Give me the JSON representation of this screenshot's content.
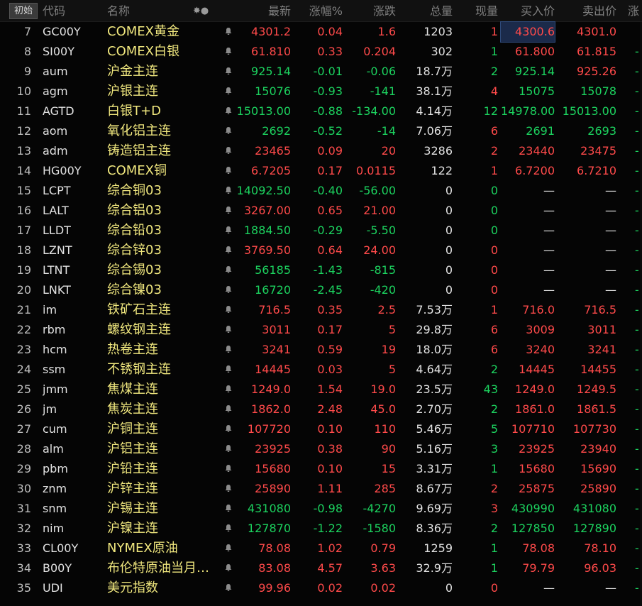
{
  "header": {
    "reset_label": "初始",
    "columns": {
      "code": "代码",
      "name": "名称",
      "icons": "✸●",
      "last": "最新",
      "pct": "涨幅%",
      "chg": "涨跌",
      "vol": "总量",
      "now": "现量",
      "bid": "买入价",
      "ask": "卖出价",
      "ext": "涨"
    }
  },
  "colors": {
    "up": "#ff4a4a",
    "down": "#1cd35f",
    "neutral": "#e2e2e2",
    "name": "#f0e77e",
    "selected_bg": "#1b2a4a"
  },
  "rows": [
    {
      "idx": "7",
      "code": "GC00Y",
      "name": "COMEX黄金",
      "last": "4301.2",
      "pct": "0.04",
      "chg": "1.6",
      "vol": "1203",
      "now": "1",
      "bid": "4300.6",
      "ask": "4301.0",
      "ext": "",
      "dir": "up",
      "now_dir": "up",
      "bid_dir": "up",
      "ask_dir": "up"
    },
    {
      "idx": "8",
      "code": "SI00Y",
      "name": "COMEX白银",
      "last": "61.810",
      "pct": "0.33",
      "chg": "0.204",
      "vol": "302",
      "now": "1",
      "bid": "61.800",
      "ask": "61.815",
      "ext": "-",
      "dir": "up",
      "now_dir": "down",
      "bid_dir": "up",
      "ask_dir": "up"
    },
    {
      "idx": "9",
      "code": "aum",
      "name": "沪金主连",
      "last": "925.14",
      "pct": "-0.01",
      "chg": "-0.06",
      "vol": "18.7万",
      "now": "2",
      "bid": "925.14",
      "ask": "925.26",
      "ext": "-",
      "dir": "down",
      "now_dir": "down",
      "bid_dir": "down",
      "ask_dir": "up"
    },
    {
      "idx": "10",
      "code": "agm",
      "name": "沪银主连",
      "last": "15076",
      "pct": "-0.93",
      "chg": "-141",
      "vol": "38.1万",
      "now": "4",
      "bid": "15075",
      "ask": "15078",
      "ext": "-",
      "dir": "down",
      "now_dir": "up",
      "bid_dir": "down",
      "ask_dir": "down"
    },
    {
      "idx": "11",
      "code": "AGTD",
      "name": "白银T+D",
      "last": "15013.00",
      "pct": "-0.88",
      "chg": "-134.00",
      "vol": "4.14万",
      "now": "12",
      "bid": "14978.00",
      "ask": "15013.00",
      "ext": "-",
      "dir": "down",
      "now_dir": "down",
      "bid_dir": "down",
      "ask_dir": "down"
    },
    {
      "idx": "12",
      "code": "aom",
      "name": "氧化铝主连",
      "last": "2692",
      "pct": "-0.52",
      "chg": "-14",
      "vol": "7.06万",
      "now": "6",
      "bid": "2691",
      "ask": "2693",
      "ext": "-",
      "dir": "down",
      "now_dir": "up",
      "bid_dir": "down",
      "ask_dir": "down"
    },
    {
      "idx": "13",
      "code": "adm",
      "name": "铸造铝主连",
      "last": "23465",
      "pct": "0.09",
      "chg": "20",
      "vol": "3286",
      "now": "2",
      "bid": "23440",
      "ask": "23475",
      "ext": "-",
      "dir": "up",
      "now_dir": "up",
      "bid_dir": "up",
      "ask_dir": "up"
    },
    {
      "idx": "14",
      "code": "HG00Y",
      "name": "COMEX铜",
      "last": "6.7205",
      "pct": "0.17",
      "chg": "0.0115",
      "vol": "122",
      "now": "1",
      "bid": "6.7200",
      "ask": "6.7210",
      "ext": "-",
      "dir": "up",
      "now_dir": "up",
      "bid_dir": "up",
      "ask_dir": "up"
    },
    {
      "idx": "15",
      "code": "LCPT",
      "name": "综合铜03",
      "last": "14092.50",
      "pct": "-0.40",
      "chg": "-56.00",
      "vol": "0",
      "now": "0",
      "bid": "—",
      "ask": "—",
      "ext": "-",
      "dir": "down",
      "now_dir": "down",
      "bid_dir": "neutral",
      "ask_dir": "neutral"
    },
    {
      "idx": "16",
      "code": "LALT",
      "name": "综合铝03",
      "last": "3267.00",
      "pct": "0.65",
      "chg": "21.00",
      "vol": "0",
      "now": "0",
      "bid": "—",
      "ask": "—",
      "ext": "-",
      "dir": "up",
      "now_dir": "down",
      "bid_dir": "neutral",
      "ask_dir": "neutral"
    },
    {
      "idx": "17",
      "code": "LLDT",
      "name": "综合铅03",
      "last": "1884.50",
      "pct": "-0.29",
      "chg": "-5.50",
      "vol": "0",
      "now": "0",
      "bid": "—",
      "ask": "—",
      "ext": "-",
      "dir": "down",
      "now_dir": "down",
      "bid_dir": "neutral",
      "ask_dir": "neutral"
    },
    {
      "idx": "18",
      "code": "LZNT",
      "name": "综合锌03",
      "last": "3769.50",
      "pct": "0.64",
      "chg": "24.00",
      "vol": "0",
      "now": "0",
      "bid": "—",
      "ask": "—",
      "ext": "-",
      "dir": "up",
      "now_dir": "up",
      "bid_dir": "neutral",
      "ask_dir": "neutral"
    },
    {
      "idx": "19",
      "code": "LTNT",
      "name": "综合锡03",
      "last": "56185",
      "pct": "-1.43",
      "chg": "-815",
      "vol": "0",
      "now": "0",
      "bid": "—",
      "ask": "—",
      "ext": "-",
      "dir": "down",
      "now_dir": "up",
      "bid_dir": "neutral",
      "ask_dir": "neutral"
    },
    {
      "idx": "20",
      "code": "LNKT",
      "name": "综合镍03",
      "last": "16720",
      "pct": "-2.45",
      "chg": "-420",
      "vol": "0",
      "now": "0",
      "bid": "—",
      "ask": "—",
      "ext": "-",
      "dir": "down",
      "now_dir": "up",
      "bid_dir": "neutral",
      "ask_dir": "neutral"
    },
    {
      "idx": "21",
      "code": "im",
      "name": "铁矿石主连",
      "last": "716.5",
      "pct": "0.35",
      "chg": "2.5",
      "vol": "7.53万",
      "now": "1",
      "bid": "716.0",
      "ask": "716.5",
      "ext": "-",
      "dir": "up",
      "now_dir": "up",
      "bid_dir": "up",
      "ask_dir": "up"
    },
    {
      "idx": "22",
      "code": "rbm",
      "name": "螺纹钢主连",
      "last": "3011",
      "pct": "0.17",
      "chg": "5",
      "vol": "29.8万",
      "now": "6",
      "bid": "3009",
      "ask": "3011",
      "ext": "-",
      "dir": "up",
      "now_dir": "up",
      "bid_dir": "up",
      "ask_dir": "up"
    },
    {
      "idx": "23",
      "code": "hcm",
      "name": "热卷主连",
      "last": "3241",
      "pct": "0.59",
      "chg": "19",
      "vol": "18.0万",
      "now": "6",
      "bid": "3240",
      "ask": "3241",
      "ext": "-",
      "dir": "up",
      "now_dir": "up",
      "bid_dir": "up",
      "ask_dir": "up"
    },
    {
      "idx": "24",
      "code": "ssm",
      "name": "不锈钢主连",
      "last": "14445",
      "pct": "0.03",
      "chg": "5",
      "vol": "4.64万",
      "now": "2",
      "bid": "14445",
      "ask": "14455",
      "ext": "-",
      "dir": "up",
      "now_dir": "down",
      "bid_dir": "up",
      "ask_dir": "up"
    },
    {
      "idx": "25",
      "code": "jmm",
      "name": "焦煤主连",
      "last": "1249.0",
      "pct": "1.54",
      "chg": "19.0",
      "vol": "23.5万",
      "now": "43",
      "bid": "1249.0",
      "ask": "1249.5",
      "ext": "-",
      "dir": "up",
      "now_dir": "down",
      "bid_dir": "up",
      "ask_dir": "up"
    },
    {
      "idx": "26",
      "code": "jm",
      "name": "焦炭主连",
      "last": "1862.0",
      "pct": "2.48",
      "chg": "45.0",
      "vol": "2.70万",
      "now": "2",
      "bid": "1861.0",
      "ask": "1861.5",
      "ext": "-",
      "dir": "up",
      "now_dir": "down",
      "bid_dir": "up",
      "ask_dir": "up"
    },
    {
      "idx": "27",
      "code": "cum",
      "name": "沪铜主连",
      "last": "107720",
      "pct": "0.10",
      "chg": "110",
      "vol": "5.46万",
      "now": "5",
      "bid": "107710",
      "ask": "107730",
      "ext": "-",
      "dir": "up",
      "now_dir": "down",
      "bid_dir": "up",
      "ask_dir": "up"
    },
    {
      "idx": "28",
      "code": "alm",
      "name": "沪铝主连",
      "last": "23925",
      "pct": "0.38",
      "chg": "90",
      "vol": "5.16万",
      "now": "3",
      "bid": "23925",
      "ask": "23940",
      "ext": "-",
      "dir": "up",
      "now_dir": "down",
      "bid_dir": "up",
      "ask_dir": "up"
    },
    {
      "idx": "29",
      "code": "pbm",
      "name": "沪铅主连",
      "last": "15680",
      "pct": "0.10",
      "chg": "15",
      "vol": "3.31万",
      "now": "1",
      "bid": "15680",
      "ask": "15690",
      "ext": "-",
      "dir": "up",
      "now_dir": "down",
      "bid_dir": "up",
      "ask_dir": "up"
    },
    {
      "idx": "30",
      "code": "znm",
      "name": "沪锌主连",
      "last": "25890",
      "pct": "1.11",
      "chg": "285",
      "vol": "8.67万",
      "now": "2",
      "bid": "25875",
      "ask": "25890",
      "ext": "-",
      "dir": "up",
      "now_dir": "up",
      "bid_dir": "up",
      "ask_dir": "up"
    },
    {
      "idx": "31",
      "code": "snm",
      "name": "沪锡主连",
      "last": "431080",
      "pct": "-0.98",
      "chg": "-4270",
      "vol": "9.69万",
      "now": "3",
      "bid": "430990",
      "ask": "431080",
      "ext": "-",
      "dir": "down",
      "now_dir": "up",
      "bid_dir": "down",
      "ask_dir": "down"
    },
    {
      "idx": "32",
      "code": "nim",
      "name": "沪镍主连",
      "last": "127870",
      "pct": "-1.22",
      "chg": "-1580",
      "vol": "8.36万",
      "now": "2",
      "bid": "127850",
      "ask": "127890",
      "ext": "-",
      "dir": "down",
      "now_dir": "down",
      "bid_dir": "down",
      "ask_dir": "down"
    },
    {
      "idx": "33",
      "code": "CL00Y",
      "name": "NYMEX原油",
      "last": "78.08",
      "pct": "1.02",
      "chg": "0.79",
      "vol": "1259",
      "now": "1",
      "bid": "78.08",
      "ask": "78.10",
      "ext": "-",
      "dir": "up",
      "now_dir": "down",
      "bid_dir": "up",
      "ask_dir": "up"
    },
    {
      "idx": "34",
      "code": "B00Y",
      "name": "布伦特原油当月…",
      "last": "83.08",
      "pct": "4.57",
      "chg": "3.63",
      "vol": "32.9万",
      "now": "1",
      "bid": "79.79",
      "ask": "96.03",
      "ext": "-",
      "dir": "up",
      "now_dir": "down",
      "bid_dir": "up",
      "ask_dir": "up"
    },
    {
      "idx": "35",
      "code": "UDI",
      "name": "美元指数",
      "last": "99.96",
      "pct": "0.02",
      "chg": "0.02",
      "vol": "0",
      "now": "0",
      "bid": "—",
      "ask": "—",
      "ext": "-",
      "dir": "up",
      "now_dir": "up",
      "bid_dir": "neutral",
      "ask_dir": "neutral"
    }
  ]
}
